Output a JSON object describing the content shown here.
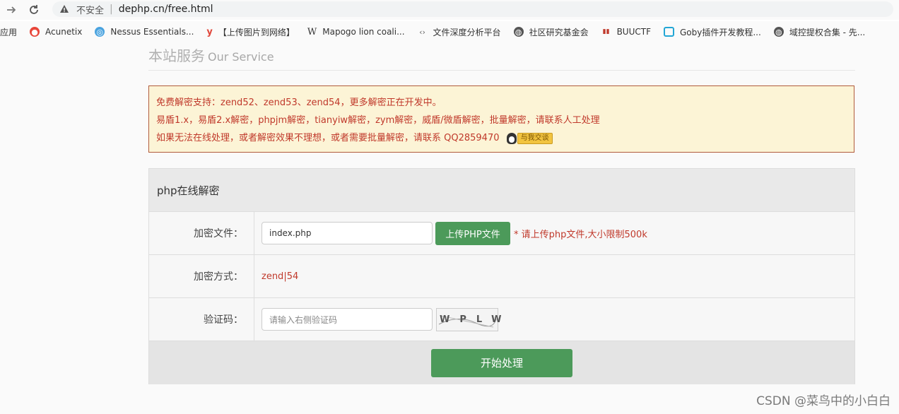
{
  "browser": {
    "secure_label": "不安全",
    "separator": "|",
    "url": "dephp.cn/free.html",
    "bookmarks": [
      {
        "label": "应用",
        "icon": "apps-icon"
      },
      {
        "label": "Acunetix",
        "icon": "acunetix-icon"
      },
      {
        "label": "Nessus Essentials...",
        "icon": "nessus-icon"
      },
      {
        "label": "y",
        "icon": "y-icon"
      },
      {
        "label": "【上传图片到网络】",
        "icon": ""
      },
      {
        "label": "W",
        "icon": "wiki-icon"
      },
      {
        "label": "Mapogo lion coali...",
        "icon": ""
      },
      {
        "label": "文件深度分析平台",
        "icon": "code-icon"
      },
      {
        "label": "社区研究基金会",
        "icon": "globe-icon"
      },
      {
        "label": "BUUCTF",
        "icon": "buuctf-icon"
      },
      {
        "label": "Goby插件开发教程...",
        "icon": "bilibili-icon"
      },
      {
        "label": "域控提权合集 - 先...",
        "icon": "globe-icon"
      }
    ]
  },
  "page": {
    "heading": "本站服务",
    "heading_en": "Our Service",
    "notice": {
      "line1": "免费解密支持：zend52、zend53、zend54，更多解密正在开发中。",
      "line2": "易盾1.x，易盾2.x解密，phpjm解密，tianyiw解密，zym解密，威盾/微盾解密，批量解密，请联系人工处理",
      "line3": "如果无法在线处理，或者解密效果不理想，或者需要批量解密，请联系 QQ2859470",
      "qq_button": "与我交谈"
    },
    "panel": {
      "title": "php在线解密",
      "file_label": "加密文件：",
      "file_value": "index.php",
      "upload_button": "上传PHP文件",
      "file_hint": "* 请上传php文件,大小限制500k",
      "method_label": "加密方式：",
      "method_value": "zend|54",
      "captcha_label": "验证码：",
      "captcha_placeholder": "请输入右侧验证码",
      "captcha_text": "WPLW",
      "start_button": "开始处理"
    }
  },
  "watermark": "CSDN @菜鸟中的小白白"
}
